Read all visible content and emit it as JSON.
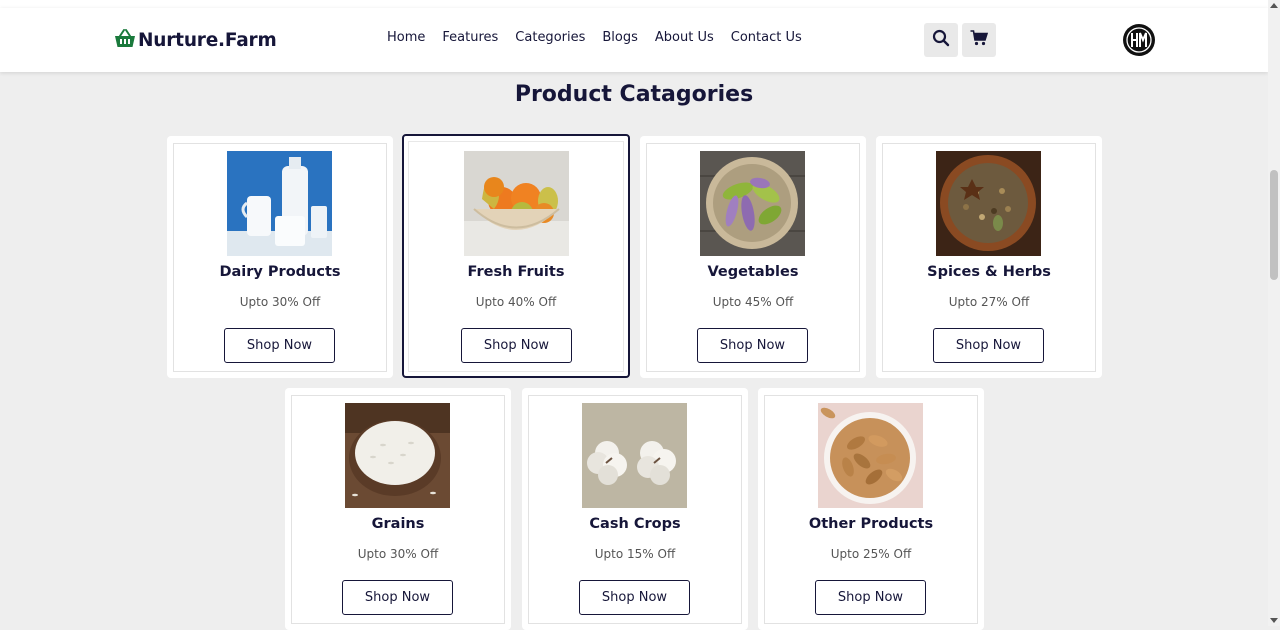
{
  "brand": {
    "name": "Nurture.Farm",
    "accent": "#1a7a3c"
  },
  "nav": {
    "links": [
      "Home",
      "Features",
      "Categories",
      "Blogs",
      "About Us",
      "Contact Us"
    ]
  },
  "header_icons": [
    "search-icon",
    "cart-icon",
    "avatar-logo"
  ],
  "section": {
    "title": "Product Catagories"
  },
  "categories": [
    {
      "title": "Dairy Products",
      "offer": "Upto 30% Off",
      "button": "Shop Now",
      "image": "milk"
    },
    {
      "title": "Fresh Fruits",
      "offer": "Upto 40% Off",
      "button": "Shop Now",
      "image": "fruits",
      "selected": true
    },
    {
      "title": "Vegetables",
      "offer": "Upto 45% Off",
      "button": "Shop Now",
      "image": "peppers"
    },
    {
      "title": "Spices & Herbs",
      "offer": "Upto 27% Off",
      "button": "Shop Now",
      "image": "spices"
    },
    {
      "title": "Grains",
      "offer": "Upto 30% Off",
      "button": "Shop Now",
      "image": "rice"
    },
    {
      "title": "Cash Crops",
      "offer": "Upto 15% Off",
      "button": "Shop Now",
      "image": "cotton"
    },
    {
      "title": "Other Products",
      "offer": "Upto 25% Off",
      "button": "Shop Now",
      "image": "peanuts"
    }
  ],
  "colors": {
    "navy": "#161639",
    "background": "#eeeeee",
    "card": "#ffffff"
  }
}
